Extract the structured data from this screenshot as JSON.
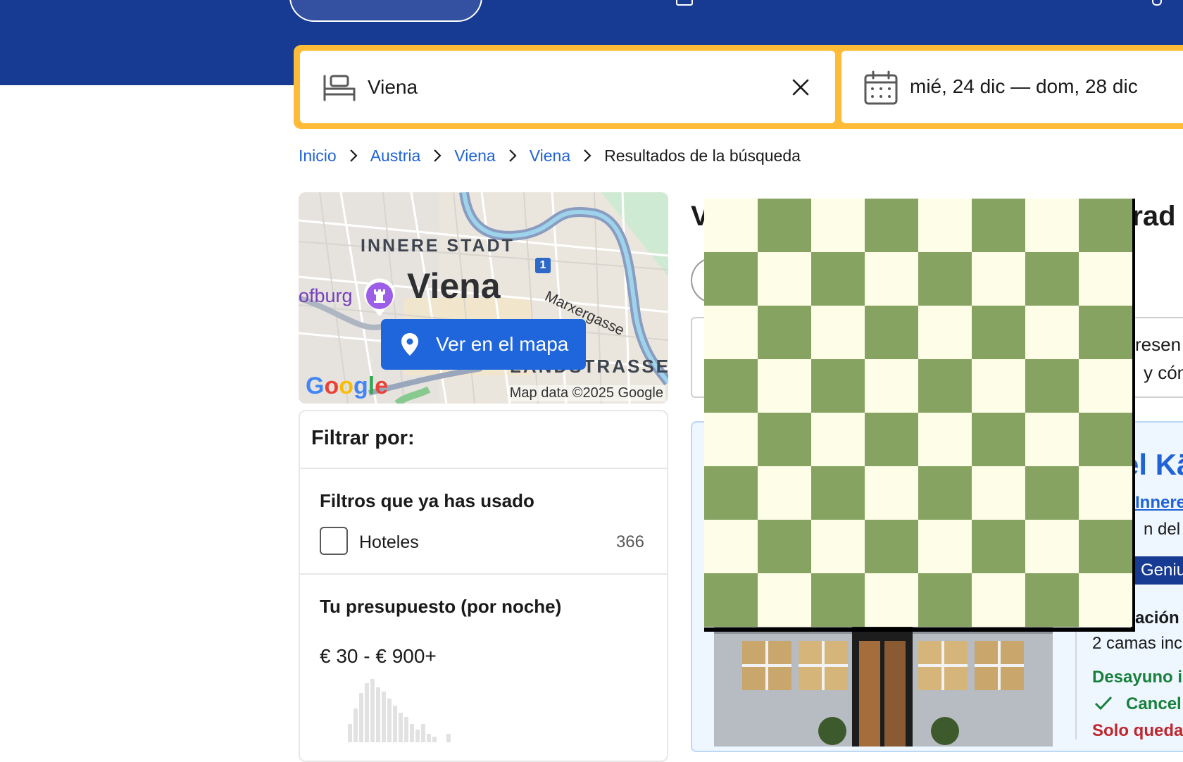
{
  "header": {
    "nav_icons": [
      "stays-pill",
      "flights",
      "car-rental-icon",
      "attractions",
      "account-icon"
    ]
  },
  "search": {
    "destination": "Viena",
    "dates": "mié, 24 dic  —  dom, 28 dic"
  },
  "breadcrumb": {
    "items": [
      "Inicio",
      "Austria",
      "Viena",
      "Viena"
    ],
    "current": "Resultados de la búsqueda"
  },
  "map": {
    "district": "INNERE STADT",
    "city": "Viena",
    "poi": "ofburg",
    "street": "Marxergasse",
    "district2": "LANDSTRASSE",
    "shield": "1",
    "button": "Ver en el mapa",
    "google": "Google",
    "copyright": "Map data ©2025 Google"
  },
  "filters": {
    "title": "Filtrar por:",
    "used_title": "Filtros que ya has usado",
    "used_items": [
      {
        "label": "Hoteles",
        "count": "366"
      }
    ],
    "budget_title": "Tu presupuesto (por noche)",
    "budget_range": "€ 30 - € 900+"
  },
  "results": {
    "title_left": "V",
    "title_right": "trad",
    "info_line1": "resen",
    "info_line2": "y cón",
    "card": {
      "name": "el Kä",
      "location": "Innere",
      "distance": "n del c",
      "genius": "Geniu",
      "room": "ación",
      "beds": "2 camas inc",
      "breakfast": "Desayuno i",
      "cancel": "Cancel",
      "availability": "Solo queda"
    }
  },
  "colors": {
    "brand_blue": "#173a93",
    "search_yellow": "#febb37",
    "link_blue": "#1f63d6",
    "board_light": "#fefde8",
    "board_dark": "#86a362"
  }
}
